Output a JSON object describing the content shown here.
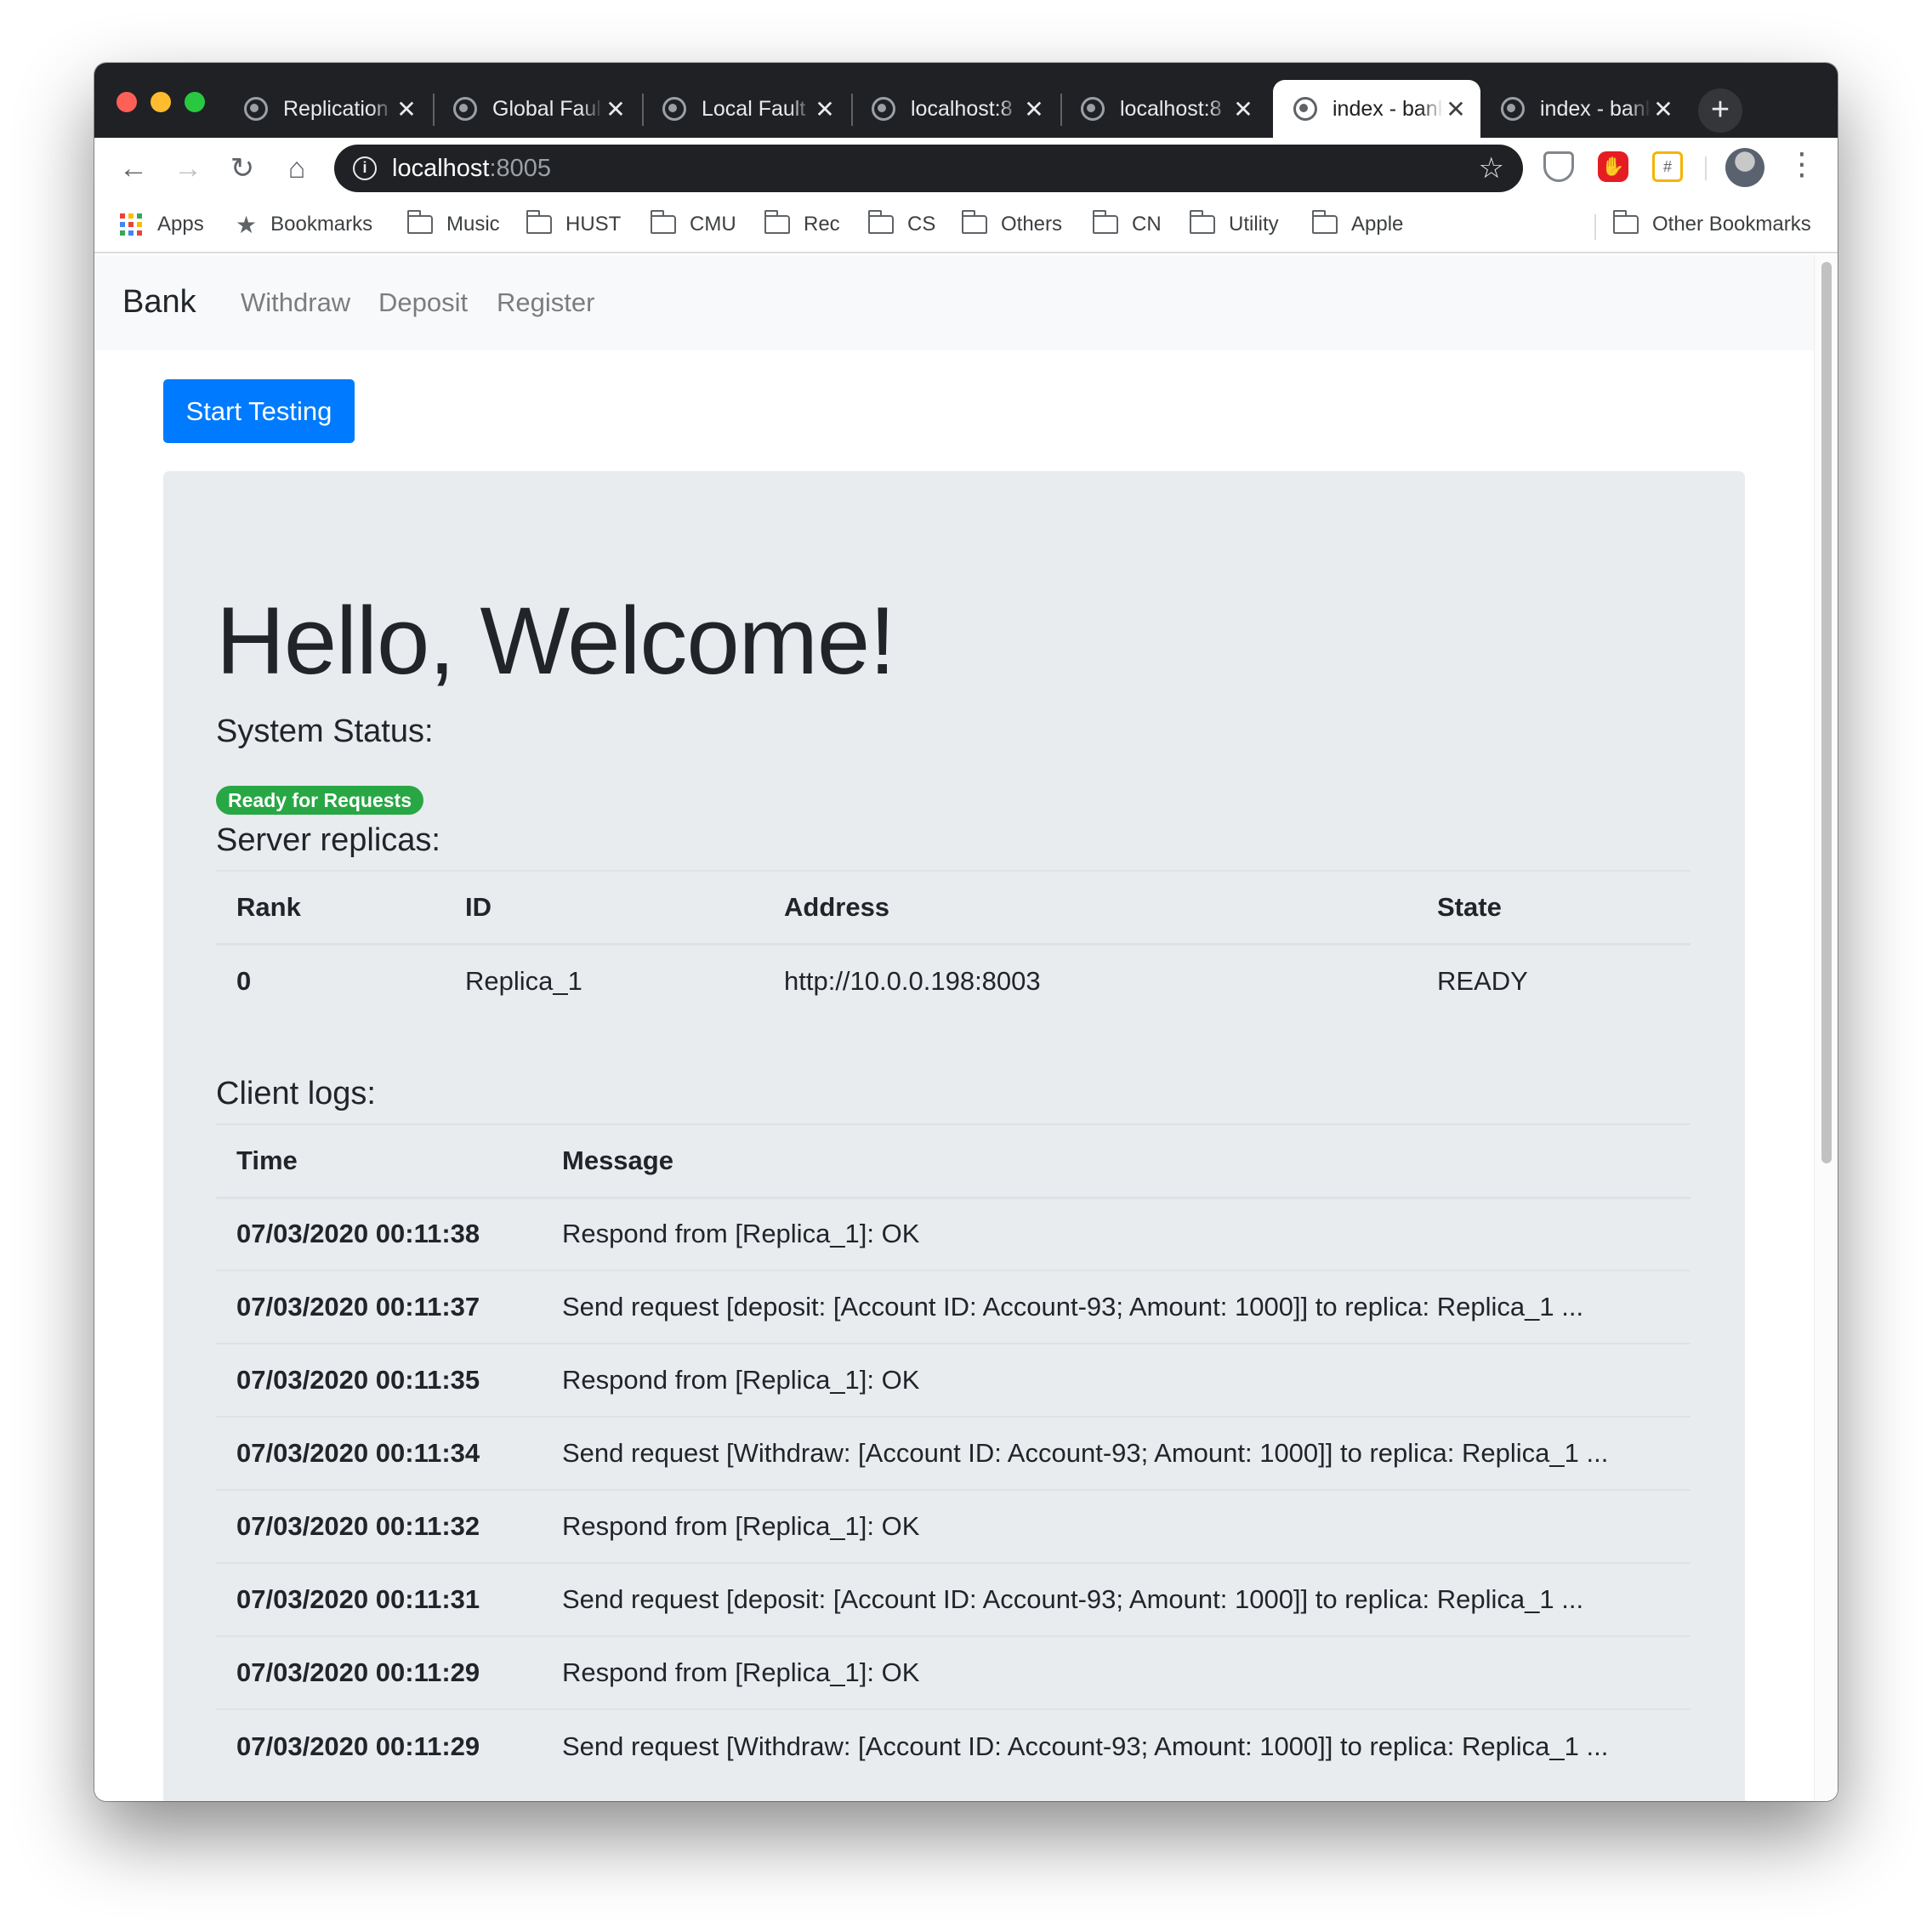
{
  "browser": {
    "tabs": [
      {
        "title": "Replication",
        "active": false
      },
      {
        "title": "Global Fault",
        "active": false
      },
      {
        "title": "Local Fault",
        "active": false
      },
      {
        "title": "localhost:8",
        "active": false
      },
      {
        "title": "localhost:8",
        "active": false
      },
      {
        "title": "index - bank",
        "active": true
      },
      {
        "title": "index - bank",
        "active": false
      }
    ],
    "new_tab_label": "+",
    "address": {
      "host": "localhost",
      "port": ":8005"
    },
    "bookmarks": [
      {
        "label": "Apps",
        "icon": "apps-grid-icon"
      },
      {
        "label": "Bookmarks",
        "icon": "star-icon"
      },
      {
        "label": "Music",
        "icon": "folder-icon"
      },
      {
        "label": "HUST",
        "icon": "folder-icon"
      },
      {
        "label": "CMU",
        "icon": "folder-icon"
      },
      {
        "label": "Rec",
        "icon": "folder-icon"
      },
      {
        "label": "CS",
        "icon": "folder-icon"
      },
      {
        "label": "Others",
        "icon": "folder-icon"
      },
      {
        "label": "CN",
        "icon": "folder-icon"
      },
      {
        "label": "Utility",
        "icon": "folder-icon"
      },
      {
        "label": "Apple",
        "icon": "folder-icon"
      }
    ],
    "other_bookmarks": "Other Bookmarks"
  },
  "navbar": {
    "brand": "Bank",
    "links": [
      "Withdraw",
      "Deposit",
      "Register"
    ]
  },
  "start_button": "Start Testing",
  "jumbotron": {
    "title": "Hello, Welcome!",
    "system_status_label": "System Status:",
    "status_badge": "Ready for Requests",
    "replicas_label": "Server replicas:",
    "replicas_table": {
      "headers": [
        "Rank",
        "ID",
        "Address",
        "State"
      ],
      "rows": [
        [
          "0",
          "Replica_1",
          "http://10.0.0.198:8003",
          "READY"
        ]
      ]
    },
    "logs_label": "Client logs:",
    "logs_table": {
      "headers": [
        "Time",
        "Message"
      ],
      "rows": [
        [
          "07/03/2020 00:11:38",
          "Respond from [Replica_1]: OK"
        ],
        [
          "07/03/2020 00:11:37",
          "Send request [deposit: [Account ID: Account-93; Amount: 1000]] to replica: Replica_1 ..."
        ],
        [
          "07/03/2020 00:11:35",
          "Respond from [Replica_1]: OK"
        ],
        [
          "07/03/2020 00:11:34",
          "Send request [Withdraw: [Account ID: Account-93; Amount: 1000]] to replica: Replica_1 ..."
        ],
        [
          "07/03/2020 00:11:32",
          "Respond from [Replica_1]: OK"
        ],
        [
          "07/03/2020 00:11:31",
          "Send request [deposit: [Account ID: Account-93; Amount: 1000]] to replica: Replica_1 ..."
        ],
        [
          "07/03/2020 00:11:29",
          "Respond from [Replica_1]: OK"
        ],
        [
          "07/03/2020 00:11:29",
          "Send request [Withdraw: [Account ID: Account-93; Amount: 1000]] to replica: Replica_1 ..."
        ]
      ]
    }
  },
  "colors": {
    "primary": "#007bff",
    "success": "#28a745",
    "jumbotron_bg": "#e9ecef",
    "tabstrip_bg": "#202124"
  }
}
